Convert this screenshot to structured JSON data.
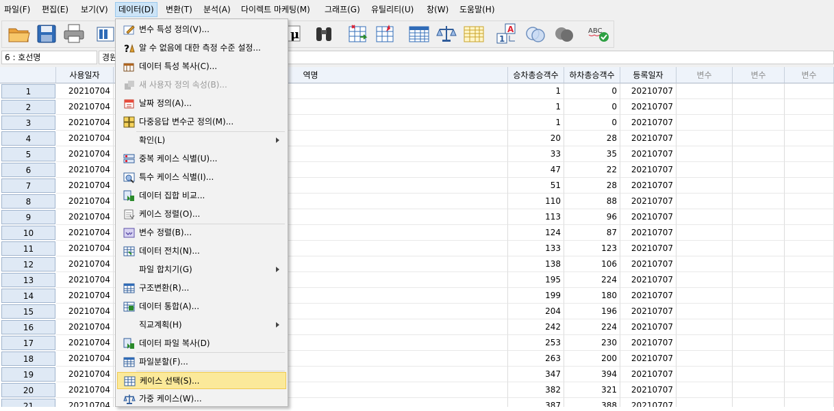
{
  "menubar": {
    "items": [
      {
        "label": "파일(F)"
      },
      {
        "label": "편집(E)"
      },
      {
        "label": "보기(V)"
      },
      {
        "label": "데이터(D)"
      },
      {
        "label": "변환(T)"
      },
      {
        "label": "분석(A)"
      },
      {
        "label": "다이렉트 마케팅(M)"
      },
      {
        "label": "그래프(G)"
      },
      {
        "label": "유틸리티(U)"
      },
      {
        "label": "창(W)"
      },
      {
        "label": "도움말(H)"
      }
    ]
  },
  "editrow": {
    "cell_ref": "6 : 호선명",
    "cell_value": "경원"
  },
  "toolbar": {
    "mu_glyph": "μ",
    "abc_label": "ABC",
    "letter_a": "A",
    "digit_1": "1"
  },
  "grid": {
    "columns": [
      "사용일자",
      "역명",
      "승차총승객수",
      "하차총승객수",
      "등록일자",
      "변수",
      "변수",
      "변수"
    ],
    "rows": [
      {
        "num": "1",
        "date": "20210704",
        "board": "1",
        "alight": "0",
        "reg": "20210707"
      },
      {
        "num": "2",
        "date": "20210704",
        "board": "1",
        "alight": "0",
        "reg": "20210707"
      },
      {
        "num": "3",
        "date": "20210704",
        "board": "1",
        "alight": "0",
        "reg": "20210707"
      },
      {
        "num": "4",
        "date": "20210704",
        "board": "20",
        "alight": "28",
        "reg": "20210707"
      },
      {
        "num": "5",
        "date": "20210704",
        "board": "33",
        "alight": "35",
        "reg": "20210707"
      },
      {
        "num": "6",
        "date": "20210704",
        "board": "47",
        "alight": "22",
        "reg": "20210707"
      },
      {
        "num": "7",
        "date": "20210704",
        "board": "51",
        "alight": "28",
        "reg": "20210707"
      },
      {
        "num": "8",
        "date": "20210704",
        "board": "110",
        "alight": "88",
        "reg": "20210707"
      },
      {
        "num": "9",
        "date": "20210704",
        "board": "113",
        "alight": "96",
        "reg": "20210707"
      },
      {
        "num": "10",
        "date": "20210704",
        "board": "124",
        "alight": "87",
        "reg": "20210707"
      },
      {
        "num": "11",
        "date": "20210704",
        "board": "133",
        "alight": "123",
        "reg": "20210707"
      },
      {
        "num": "12",
        "date": "20210704",
        "board": "138",
        "alight": "106",
        "reg": "20210707"
      },
      {
        "num": "13",
        "date": "20210704",
        "board": "195",
        "alight": "224",
        "reg": "20210707"
      },
      {
        "num": "14",
        "date": "20210704",
        "board": "199",
        "alight": "180",
        "reg": "20210707"
      },
      {
        "num": "15",
        "date": "20210704",
        "board": "204",
        "alight": "196",
        "reg": "20210707"
      },
      {
        "num": "16",
        "date": "20210704",
        "board": "242",
        "alight": "224",
        "reg": "20210707"
      },
      {
        "num": "17",
        "date": "20210704",
        "board": "253",
        "alight": "230",
        "reg": "20210707"
      },
      {
        "num": "18",
        "date": "20210704",
        "board": "263",
        "alight": "200",
        "reg": "20210707"
      },
      {
        "num": "19",
        "date": "20210704",
        "board": "347",
        "alight": "394",
        "reg": "20210707"
      },
      {
        "num": "20",
        "date": "20210704",
        "board": "382",
        "alight": "321",
        "reg": "20210707"
      },
      {
        "num": "21",
        "date": "20210704",
        "board": "387",
        "alight": "388",
        "reg": "20210707"
      }
    ]
  },
  "data_menu": {
    "items": [
      {
        "label": "변수 특성 정의(V)...",
        "icon": "define-variable-properties-icon"
      },
      {
        "label": "알 수 없음에 대한 측정 수준 설정...",
        "icon": "question-measure-icon"
      },
      {
        "label": "데이터 특성 복사(C)...",
        "icon": "copy-properties-icon"
      },
      {
        "label": "새 사용자 정의 속성(B)...",
        "icon": "custom-attribute-icon",
        "disabled": true
      },
      {
        "label": "날짜 정의(A)...",
        "icon": "calendar-icon"
      },
      {
        "label": "다중응답 변수군 정의(M)...",
        "icon": "multiple-response-icon"
      },
      {
        "label": "확인(L)",
        "submenu": true
      },
      {
        "label": "중복 케이스 식별(U)...",
        "icon": "duplicate-cases-icon"
      },
      {
        "label": "특수 케이스 식별(I)...",
        "icon": "unusual-cases-icon"
      },
      {
        "label": "데이터 집합 비교...",
        "icon": "compare-datasets-icon"
      },
      {
        "label": "케이스 정렬(O)...",
        "icon": "sort-cases-icon"
      },
      {
        "label": "변수 정렬(B)...",
        "icon": "sort-variables-icon"
      },
      {
        "label": "데이터 전치(N)...",
        "icon": "transpose-icon"
      },
      {
        "label": "파일 합치기(G)",
        "submenu": true
      },
      {
        "label": "구조변환(R)...",
        "icon": "restructure-icon"
      },
      {
        "label": "데이터 통합(A)...",
        "icon": "aggregate-icon"
      },
      {
        "label": "직교계획(H)",
        "submenu": true
      },
      {
        "label": "데이터 파일 복사(D)",
        "icon": "copy-dataset-icon"
      },
      {
        "label": "파일분할(F)...",
        "icon": "split-file-icon"
      },
      {
        "label": "케이스 선택(S)...",
        "icon": "select-cases-icon",
        "selected": true
      },
      {
        "label": "가중 케이스(W)...",
        "icon": "weight-cases-icon"
      }
    ]
  }
}
